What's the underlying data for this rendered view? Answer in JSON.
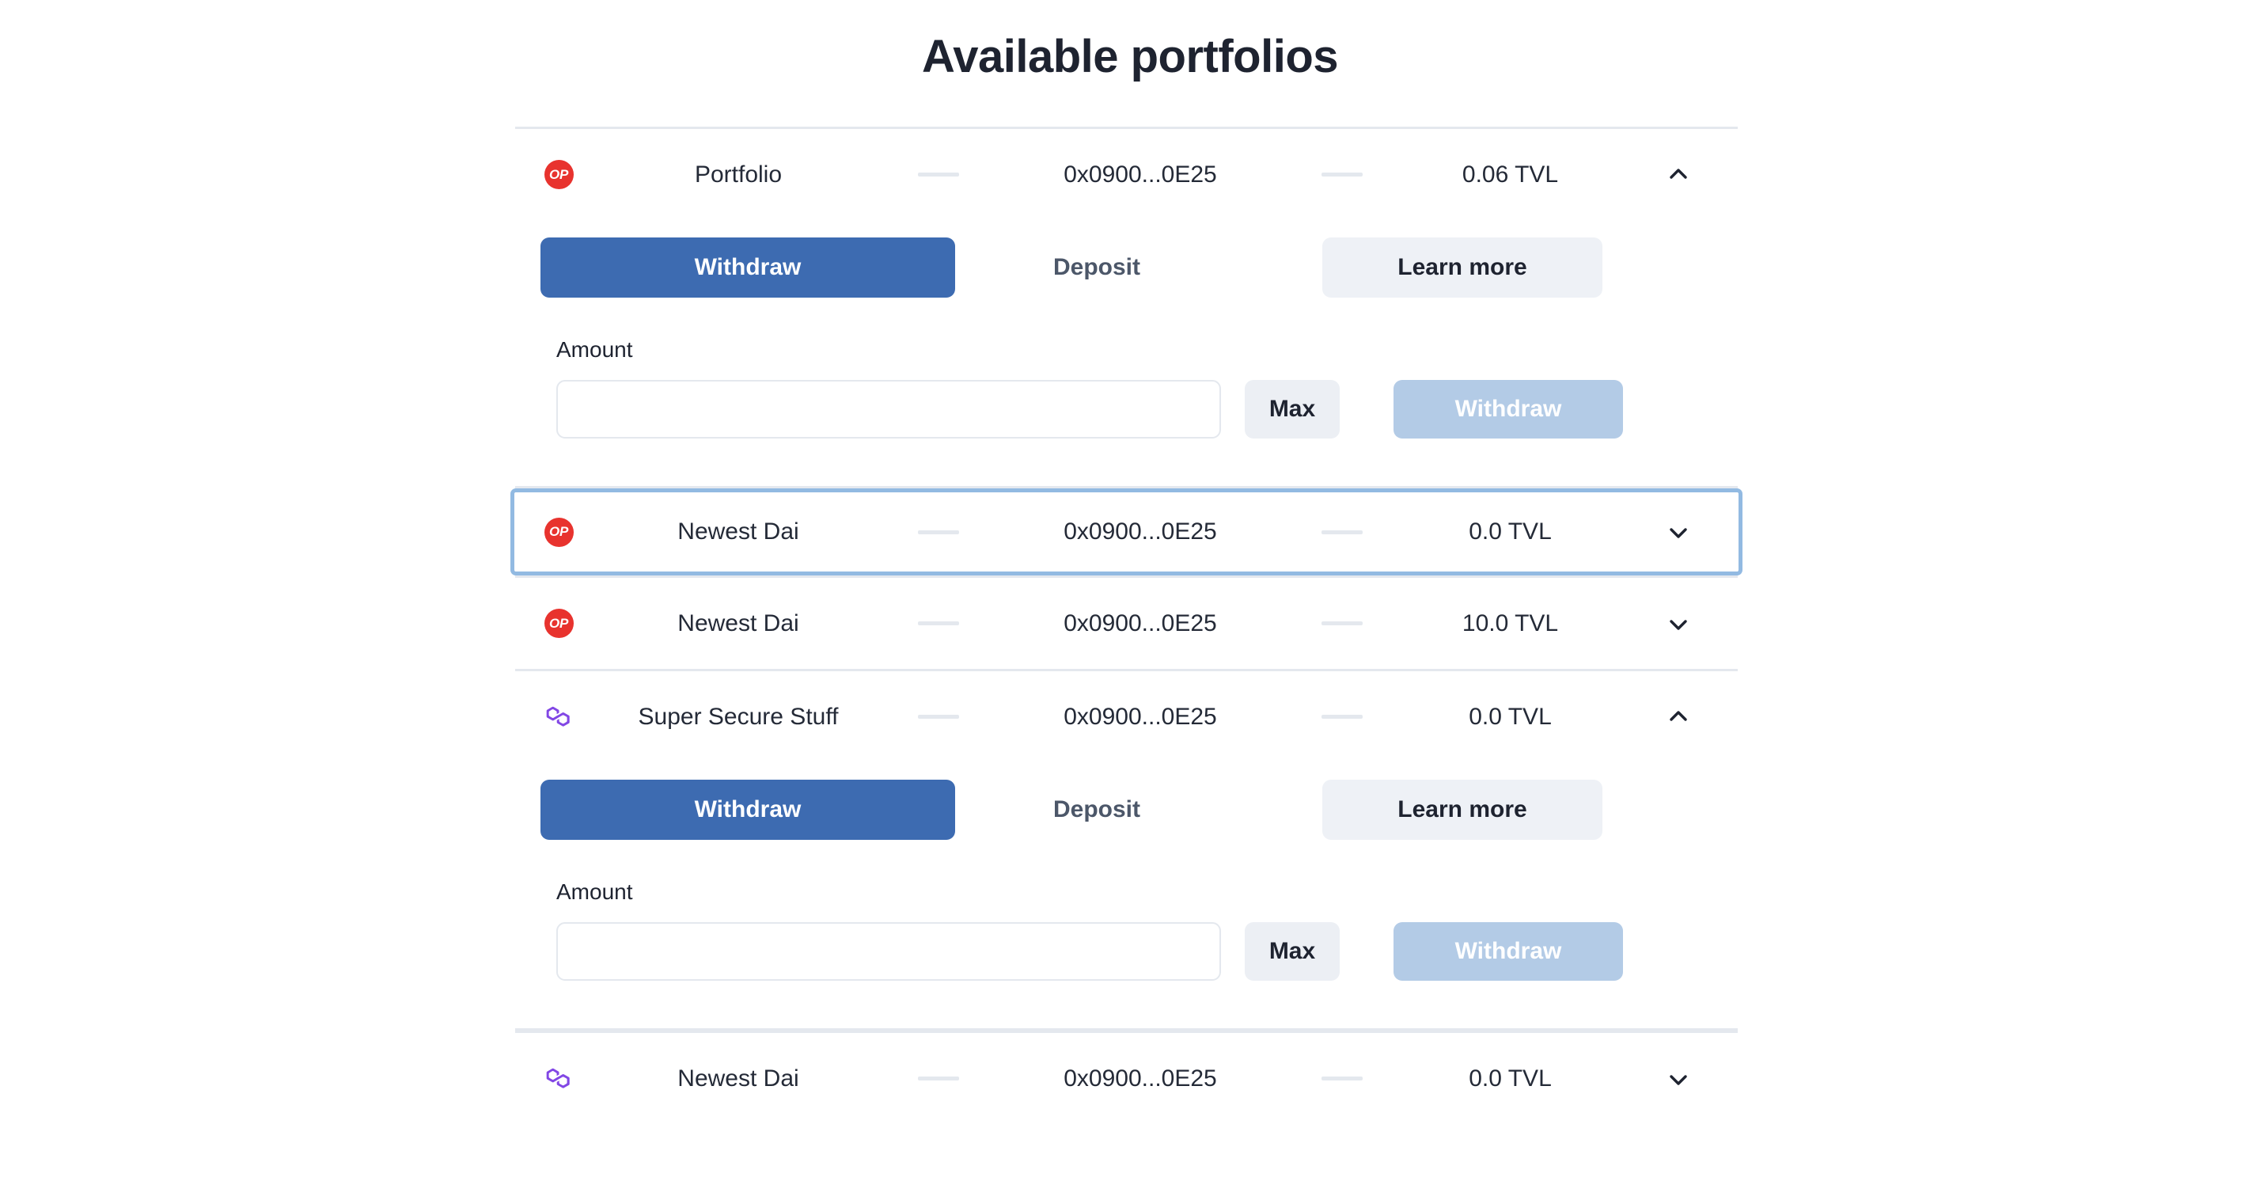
{
  "page": {
    "title": "Available portfolios",
    "accent_blue": "#3d6bb1",
    "accent_blue_disabled": "#b3cbe6",
    "selected_border": "#92bae2",
    "op_badge_color": "#e8332e",
    "polygon_color": "#8247e5",
    "divider_color": "#e4e8ee",
    "text_color": "#242a37"
  },
  "panel": {
    "tab_withdraw": "Withdraw",
    "tab_deposit": "Deposit",
    "tab_learn_more": "Learn more",
    "amount_label": "Amount",
    "amount_value": "",
    "amount_placeholder": "",
    "max_label": "Max",
    "action_label": "Withdraw"
  },
  "rows": [
    {
      "chain_icon": "optimism-icon",
      "chain_badge_text": "OP",
      "name": "Portfolio",
      "separator": "—",
      "address": "0x0900...0E25",
      "tvl": "0.06 TVL",
      "chevron": "chevron-up-icon",
      "expanded": true,
      "selected": false
    },
    {
      "chain_icon": "optimism-icon",
      "chain_badge_text": "OP",
      "name": "Newest Dai",
      "separator": "—",
      "address": "0x0900...0E25",
      "tvl": "0.0 TVL",
      "chevron": "chevron-down-icon",
      "expanded": false,
      "selected": true
    },
    {
      "chain_icon": "optimism-icon",
      "chain_badge_text": "OP",
      "name": "Newest Dai",
      "separator": "—",
      "address": "0x0900...0E25",
      "tvl": "10.0 TVL",
      "chevron": "chevron-down-icon",
      "expanded": false,
      "selected": false
    },
    {
      "chain_icon": "polygon-icon",
      "chain_badge_text": "",
      "name": "Super Secure Stuff",
      "separator": "—",
      "address": "0x0900...0E25",
      "tvl": "0.0 TVL",
      "chevron": "chevron-up-icon",
      "expanded": true,
      "selected": false
    },
    {
      "chain_icon": "polygon-icon",
      "chain_badge_text": "",
      "name": "Newest Dai",
      "separator": "—",
      "address": "0x0900...0E25",
      "tvl": "0.0 TVL",
      "chevron": "chevron-down-icon",
      "expanded": false,
      "selected": false
    }
  ]
}
